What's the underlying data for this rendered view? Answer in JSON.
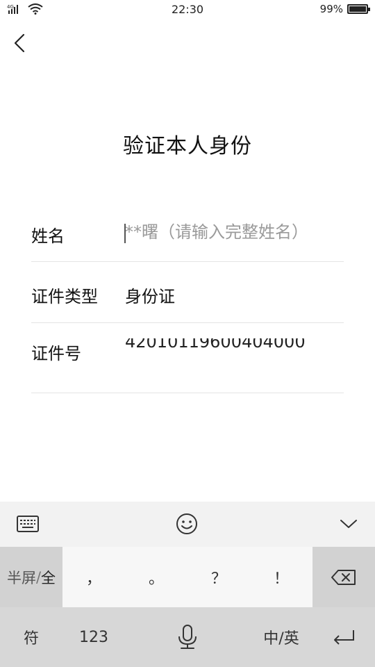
{
  "status_bar": {
    "network": "4G",
    "time": "22:30",
    "battery_percent": "99%",
    "battery_level": 0.99,
    "icons": [
      "signal-icon",
      "wifi-icon",
      "battery-icon"
    ]
  },
  "page": {
    "title": "验证本人身份"
  },
  "form": {
    "name": {
      "label": "姓名",
      "placeholder": "**曙（请输入完整姓名）",
      "value": ""
    },
    "id_type": {
      "label": "证件类型",
      "value": "身份证"
    },
    "id_number": {
      "label": "证件号",
      "value": "42010119600404000"
    }
  },
  "keyboard": {
    "toolbar_icons": [
      "keyboard-icon",
      "emoji-icon",
      "collapse-icon"
    ],
    "row1": {
      "halfwidth_label": "半屏",
      "separator": "/",
      "fullwidth_label": "全",
      "comma": "，",
      "period": "。",
      "question": "？",
      "exclamation": "！",
      "backspace_icon": "backspace-icon"
    },
    "row2": {
      "symbols": "符",
      "numbers": "123",
      "mic_icon": "microphone-icon",
      "language": "中/英",
      "enter_icon": "enter-icon"
    }
  },
  "colors": {
    "background": "#ffffff",
    "keyboard_bg": "#f2f2f2",
    "key_dark": "#d2d2d2",
    "placeholder": "#9a9a9a",
    "divider": "#e4e4e4"
  }
}
